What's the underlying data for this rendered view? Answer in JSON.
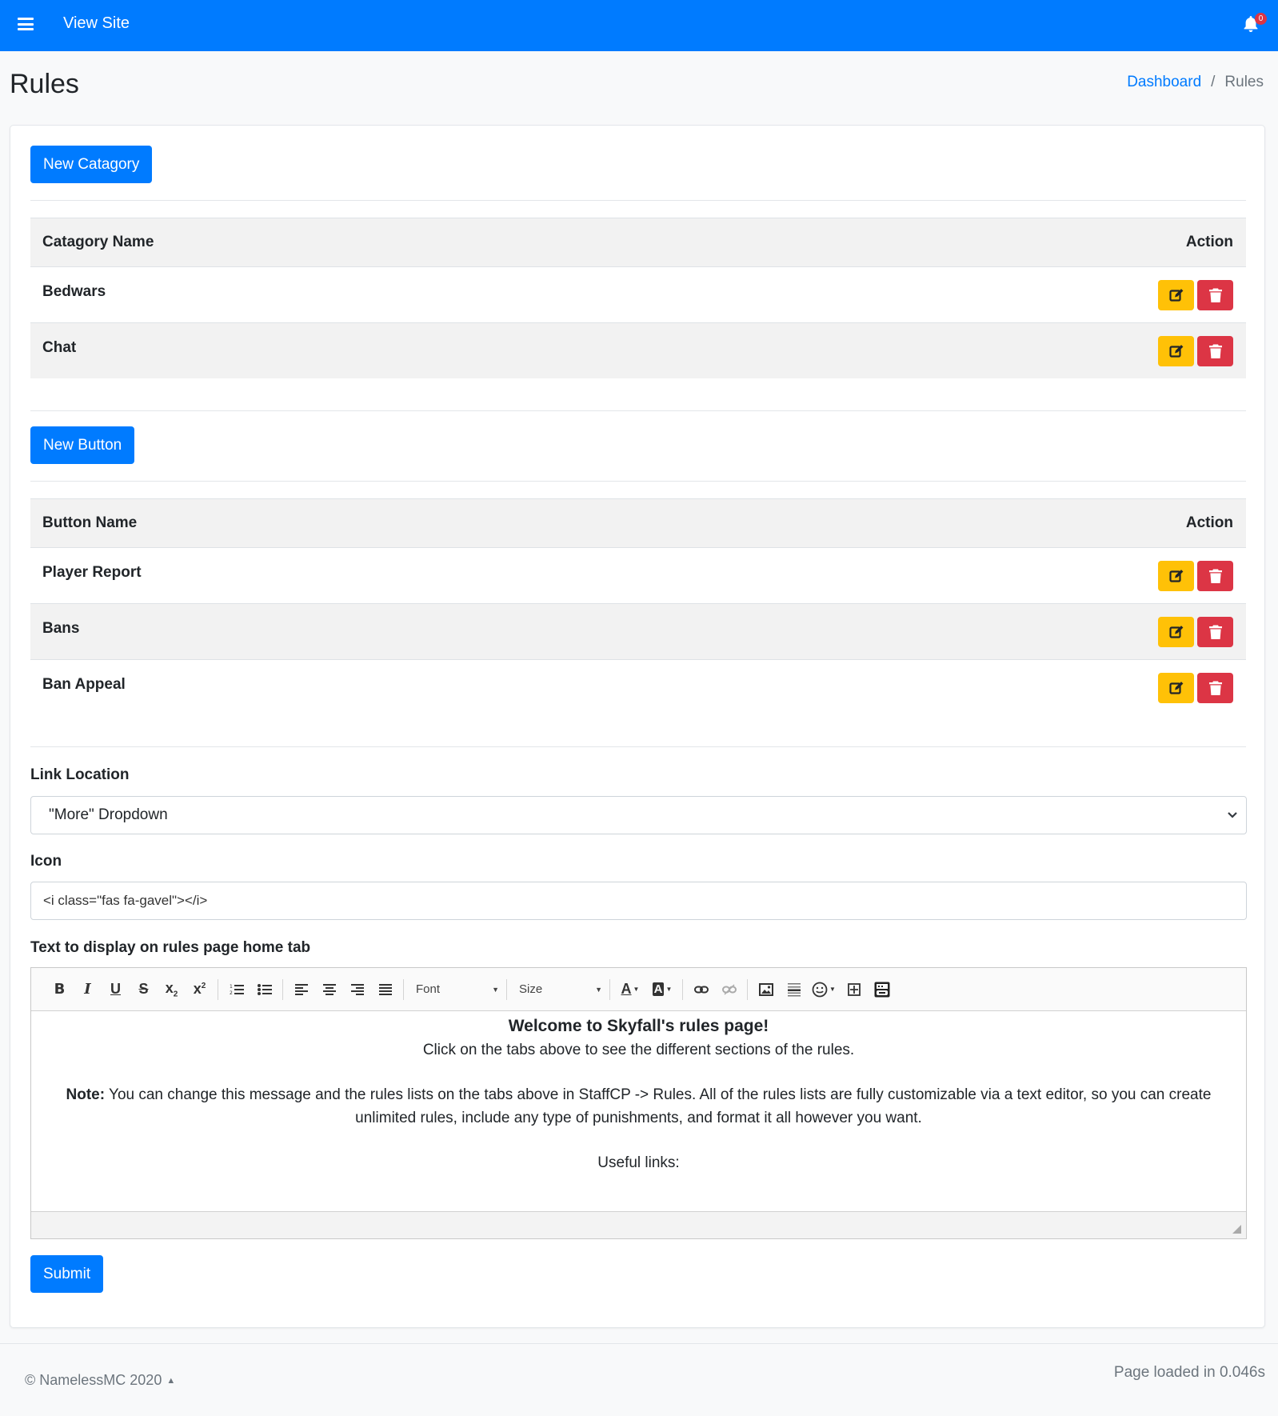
{
  "topbar": {
    "view_site": "View Site",
    "notifications_count": "0"
  },
  "page": {
    "title": "Rules"
  },
  "breadcrumb": {
    "dashboard": "Dashboard",
    "separator": "/",
    "current": "Rules"
  },
  "categories": {
    "new_label": "New Catagory",
    "header_name": "Catagory Name",
    "header_action": "Action",
    "rows": [
      "Bedwars",
      "Chat"
    ]
  },
  "buttons": {
    "new_label": "New Button",
    "header_name": "Button Name",
    "header_action": "Action",
    "rows": [
      "Player Report",
      "Bans",
      "Ban Appeal"
    ]
  },
  "form": {
    "link_location_label": "Link Location",
    "link_location_value": "\"More\" Dropdown",
    "icon_label": "Icon",
    "icon_value": "<i class=\"fas fa-gavel\"></i>",
    "text_label": "Text to display on rules page home tab",
    "submit_label": "Submit"
  },
  "editor": {
    "font_label": "Font",
    "size_label": "Size",
    "heading": "Welcome to Skyfall's rules page!",
    "line1": "Click on the tabs above to see the different sections of the rules.",
    "note_label": "Note:",
    "note_text": " You can change this message and the rules lists on the tabs above in StaffCP -> Rules. All of the rules lists are fully customizable via a text editor, so you can create unlimited rules, include any type of punishments, and format it all however you want.",
    "useful_links": "Useful links:"
  },
  "footer": {
    "copyright": "© NamelessMC 2020",
    "loaded": "Page loaded in 0.046s"
  },
  "colors": {
    "primary": "#007bff",
    "warning": "#ffc107",
    "danger": "#dc3545",
    "muted": "#6c757d"
  }
}
